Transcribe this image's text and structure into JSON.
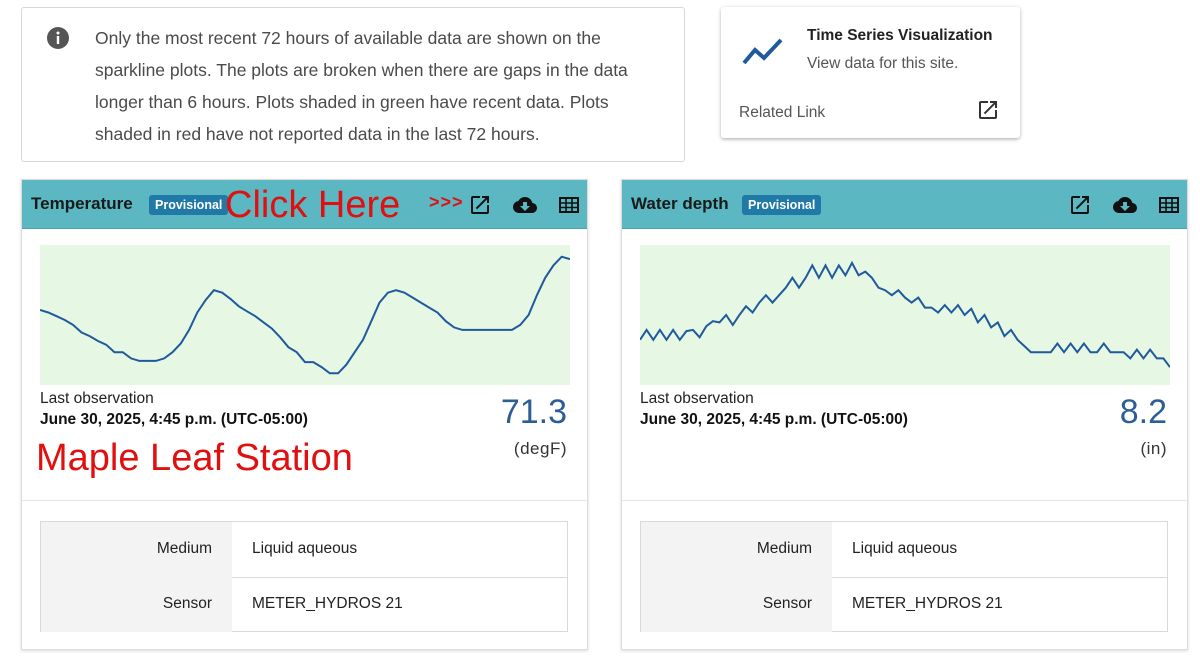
{
  "info": {
    "text": "Only the most recent 72 hours of available data are shown on the sparkline plots. The plots are broken when there are gaps in the data longer than 6 hours. Plots shaded in green have recent data. Plots shaded in red have not reported data in the last 72 hours.",
    "icon": "info-icon"
  },
  "ts_card": {
    "title": "Time Series Visualization",
    "subtitle": "View data for this site.",
    "related": "Related Link",
    "icon": "trend-line-icon",
    "link_icon": "open-in-new-icon"
  },
  "colors": {
    "header": "#5bb8c3",
    "badge": "#2079a6",
    "spark_fill": "#e6f7e4",
    "spark_line": "#1f5a9c",
    "value": "#2d5d95",
    "annotation": "#e01010"
  },
  "panels": [
    {
      "title": "Temperature",
      "badge": "Provisional",
      "last_label": "Last observation",
      "last_date": "June 30, 2025, 4:45 p.m. (UTC-05:00)",
      "value": "71.3",
      "unit": "(degF)",
      "annotation_click": "Click Here",
      "annotation_arrows": ">>>",
      "annotation_station": "Maple Leaf Station",
      "meta": [
        {
          "key": "Medium",
          "value": "Liquid aqueous"
        },
        {
          "key": "Sensor",
          "value": "METER_HYDROS 21"
        }
      ]
    },
    {
      "title": "Water depth",
      "badge": "Provisional",
      "last_label": "Last observation",
      "last_date": "June 30, 2025, 4:45 p.m. (UTC-05:00)",
      "value": "8.2",
      "unit": "(in)",
      "meta": [
        {
          "key": "Medium",
          "value": "Liquid aqueous"
        },
        {
          "key": "Sensor",
          "value": "METER_HYDROS 21"
        }
      ]
    }
  ],
  "chart_data": [
    {
      "type": "line",
      "series": [
        {
          "values": [
            0.54,
            0.52,
            0.49,
            0.46,
            0.42,
            0.36,
            0.33,
            0.29,
            0.26,
            0.2,
            0.2,
            0.15,
            0.13,
            0.13,
            0.13,
            0.15,
            0.2,
            0.27,
            0.38,
            0.52,
            0.62,
            0.7,
            0.68,
            0.63,
            0.57,
            0.53,
            0.49,
            0.44,
            0.39,
            0.32,
            0.24,
            0.2,
            0.12,
            0.12,
            0.08,
            0.03,
            0.03,
            0.1,
            0.2,
            0.3,
            0.45,
            0.6,
            0.68,
            0.7,
            0.68,
            0.64,
            0.6,
            0.56,
            0.52,
            0.45,
            0.4,
            0.38,
            0.38,
            0.38,
            0.38,
            0.38,
            0.38,
            0.38,
            0.42,
            0.5,
            0.66,
            0.8,
            0.9,
            0.97,
            0.95
          ]
        }
      ]
    },
    {
      "type": "line",
      "series": [
        {
          "values": [
            0.3,
            0.38,
            0.3,
            0.38,
            0.3,
            0.38,
            0.3,
            0.37,
            0.38,
            0.32,
            0.41,
            0.45,
            0.44,
            0.5,
            0.42,
            0.5,
            0.57,
            0.52,
            0.6,
            0.66,
            0.6,
            0.66,
            0.72,
            0.8,
            0.72,
            0.8,
            0.9,
            0.8,
            0.9,
            0.8,
            0.9,
            0.82,
            0.92,
            0.82,
            0.85,
            0.8,
            0.72,
            0.7,
            0.66,
            0.7,
            0.64,
            0.6,
            0.64,
            0.56,
            0.56,
            0.52,
            0.58,
            0.52,
            0.58,
            0.5,
            0.55,
            0.44,
            0.5,
            0.4,
            0.44,
            0.33,
            0.38,
            0.3,
            0.25,
            0.2,
            0.2,
            0.2,
            0.2,
            0.27,
            0.2,
            0.27,
            0.2,
            0.27,
            0.2,
            0.2,
            0.27,
            0.2,
            0.2,
            0.2,
            0.15,
            0.22,
            0.15,
            0.22,
            0.15,
            0.15,
            0.08
          ]
        }
      ]
    }
  ]
}
